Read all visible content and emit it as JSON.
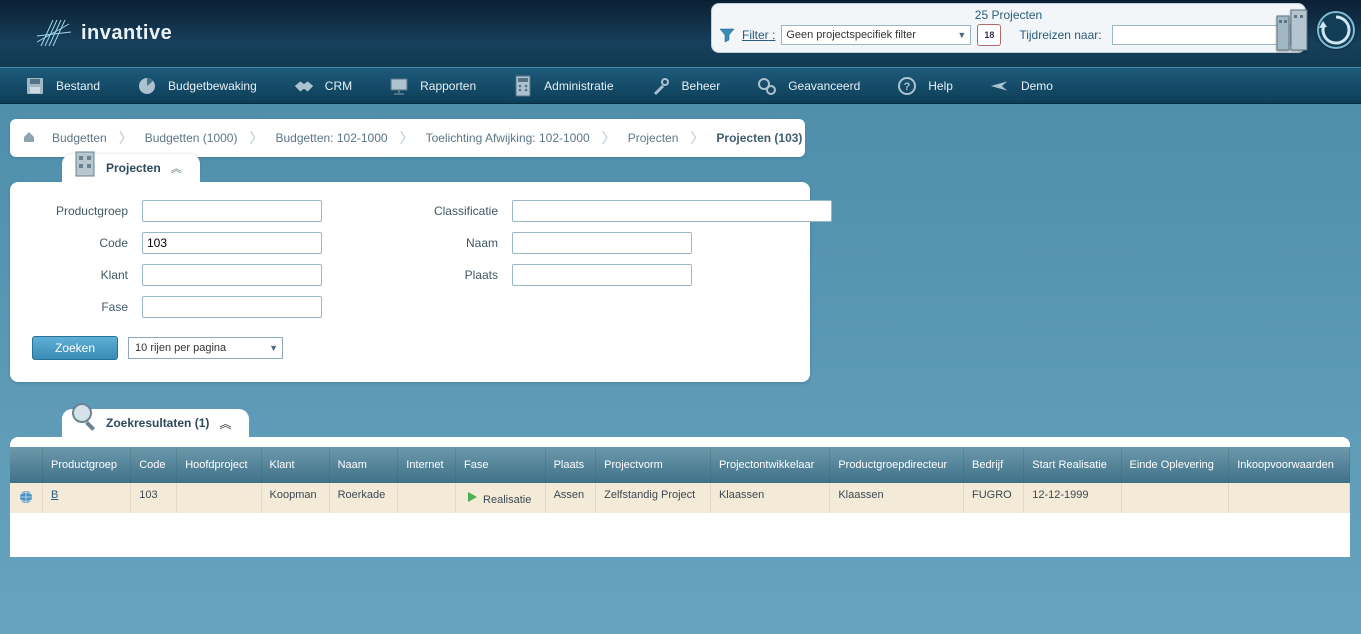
{
  "header": {
    "projects_count": "25 Projecten",
    "filter_label": "Filter",
    "filter_value": "Geen projectspecifiek filter",
    "calendar_day": "18",
    "time_travel_label": "Tijdreizen naar:",
    "time_travel_value": ""
  },
  "logo": {
    "text": "invantive"
  },
  "nav": [
    {
      "label": "Bestand",
      "icon": "save-icon"
    },
    {
      "label": "Budgetbewaking",
      "icon": "budget-icon"
    },
    {
      "label": "CRM",
      "icon": "handshake-icon"
    },
    {
      "label": "Rapporten",
      "icon": "presentation-icon"
    },
    {
      "label": "Administratie",
      "icon": "calculator-icon"
    },
    {
      "label": "Beheer",
      "icon": "tools-icon"
    },
    {
      "label": "Geavanceerd",
      "icon": "gears-icon"
    },
    {
      "label": "Help",
      "icon": "help-icon"
    },
    {
      "label": "Demo",
      "icon": "plane-icon"
    }
  ],
  "breadcrumb": [
    "Budgetten",
    "Budgetten (1000)",
    "Budgetten: 102-1000",
    "Toelichting Afwijking: 102-1000",
    "Projecten",
    "Projecten (103)"
  ],
  "search_panel": {
    "title": "Projecten",
    "labels": {
      "productgroep": "Productgroep",
      "code": "Code",
      "klant": "Klant",
      "fase": "Fase",
      "classificatie": "Classificatie",
      "naam": "Naam",
      "plaats": "Plaats"
    },
    "values": {
      "productgroep": "",
      "code": "103",
      "klant": "",
      "fase": "",
      "classificatie": "",
      "naam": "",
      "plaats": ""
    },
    "search_button": "Zoeken",
    "rows_per_page": "10 rijen per pagina"
  },
  "results_panel": {
    "title": "Zoekresultaten (1)",
    "columns": [
      "",
      "Productgroep",
      "Code",
      "Hoofdproject",
      "Klant",
      "Naam",
      "Internet",
      "Fase",
      "Plaats",
      "Projectvorm",
      "Projectontwikkelaar",
      "Productgroepdirecteur",
      "Bedrijf",
      "Start Realisatie",
      "Einde Oplevering",
      "Inkoopvoorwaarden"
    ],
    "rows": [
      {
        "productgroep": "B",
        "code": "103",
        "hoofdproject": "",
        "klant": "Koopman",
        "naam": "Roerkade",
        "internet": "",
        "fase": "Realisatie",
        "plaats": "Assen",
        "projectvorm": "Zelfstandig Project",
        "projectontwikkelaar": "Klaassen",
        "productgroepdirecteur": "Klaassen",
        "bedrijf": "FUGRO",
        "start_realisatie": "12-12-1999",
        "einde_oplevering": "",
        "inkoopvoorwaarden": ""
      }
    ]
  }
}
